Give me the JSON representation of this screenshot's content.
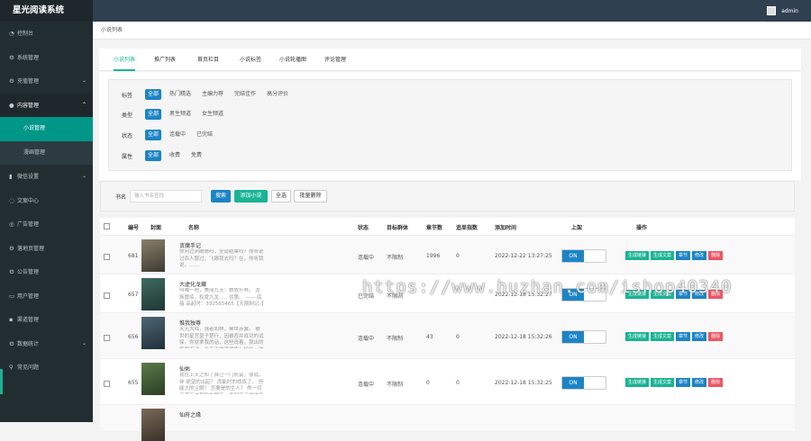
{
  "app": {
    "title": "星光阅读系统"
  },
  "topbar": {
    "user": "admin"
  },
  "sidebar": {
    "items": [
      {
        "label": "控制台",
        "icon": "dashboard-icon"
      },
      {
        "label": "系统管理",
        "icon": "gear-icon"
      },
      {
        "label": "充值管理",
        "icon": "gear-icon"
      },
      {
        "label": "内容管理",
        "icon": "circle-icon"
      },
      {
        "label": "微信设置",
        "icon": "chart-icon"
      },
      {
        "label": "文案中心",
        "icon": "chat-icon"
      },
      {
        "label": "广告管理",
        "icon": "megaphone-icon"
      },
      {
        "label": "落地页管理",
        "icon": "gear-icon"
      },
      {
        "label": "公告管理",
        "icon": "gear-icon"
      },
      {
        "label": "用户管理",
        "icon": "monitor-icon"
      },
      {
        "label": "渠道管理",
        "icon": "plug-icon"
      },
      {
        "label": "数据统计",
        "icon": "gear-icon"
      },
      {
        "label": "常见问题",
        "icon": "link-icon"
      }
    ],
    "subitems": [
      {
        "label": "小说管理"
      },
      {
        "label": "漫画管理"
      }
    ]
  },
  "breadcrumb": "小说列表",
  "tabs": [
    "小说列表",
    "推广列表",
    "首页栏目",
    "小说标签",
    "小说轮播图",
    "评论管理"
  ],
  "filters": {
    "tag": {
      "label": "标签",
      "options": [
        "全部",
        "热门精选",
        "主编力荐",
        "完结佳作",
        "高分评价"
      ]
    },
    "type": {
      "label": "类型",
      "options": [
        "全部",
        "男生频道",
        "女生频道"
      ]
    },
    "status": {
      "label": "状态",
      "options": [
        "全部",
        "连载中",
        "已完结"
      ]
    },
    "attr": {
      "label": "属性",
      "options": [
        "全部",
        "收费",
        "免费"
      ]
    }
  },
  "search": {
    "label": "书名",
    "placeholder": "输入书名查找",
    "search_btn": "搜索",
    "add_btn": "添加小说",
    "select_all_btn": "全选",
    "batch_delete_btn": "批量删除"
  },
  "table": {
    "headers": [
      "编号",
      "封面",
      "名称",
      "状态",
      "目标群体",
      "章节数",
      "追单指数",
      "添加时间",
      "上架",
      "操作"
    ],
    "rows": [
      {
        "id": "681",
        "name": "贪魔手记",
        "intro": "你问过闭眼睛吗，全部结果吗？你听说过杀人狠过，飞眼我去吗？在，你听我说，……",
        "status": "连载中",
        "target": "不限制",
        "chapters": "1996",
        "index": "0",
        "time": "2022-12-22 13:27:25",
        "toggle": "ON"
      },
      {
        "id": "657",
        "name": "大虚化龙藏",
        "intro": "叫喊一吧，美丽九天：数放乐界。 龙族震掠，权度九龙……住第。 —— 底蕴 高起时：392565465【无限制记。】",
        "status": "已完结",
        "target": "不限制",
        "chapters": "",
        "index": "",
        "time": "2022-12-18 15:32:27",
        "toggle": "ON"
      },
      {
        "id": "656",
        "name": "惟我独尊",
        "intro": "天元大陆，强者如林，稀世赤露。 被世的星宫皇子楚行，因被吞并成功的试探，你就拿我的话，这些说着，我出的场都不动，全步于武道修炼！加位，他的疑了。。。",
        "status": "连载中",
        "target": "不限制",
        "chapters": "43",
        "index": "0",
        "time": "2022-12-18 15:32:26",
        "toggle": "ON"
      },
      {
        "id": "655",
        "name": "仙佑",
        "intro": "我往上天之知了自己一门机会，很就。 钟 绝望的出起？ 而能时的修炼了， 但能大的尘眼？ 否要是的生人？ 然一切正道天才都除在脚下，否到至云端体用 在……",
        "status": "连载中",
        "target": "不限制",
        "chapters": "0",
        "index": "0",
        "time": "2022-12-18 15:32:25",
        "toggle": "ON"
      },
      {
        "id": "",
        "name": "仙府之缘",
        "intro": "",
        "status": "",
        "target": "",
        "chapters": "",
        "index": "",
        "time": "",
        "toggle": ""
      }
    ],
    "row_actions": [
      "生成链接",
      "生成文案",
      "章节",
      "修改",
      "删除"
    ]
  },
  "watermark": "https://www.huzhan.com/ishop40340",
  "colors": {
    "sidebar": "#222d32",
    "active_menu": "#009688",
    "primary": "#1c84c6",
    "success": "#1ab394",
    "danger": "#ed5565",
    "topbar": "#2f4050"
  }
}
